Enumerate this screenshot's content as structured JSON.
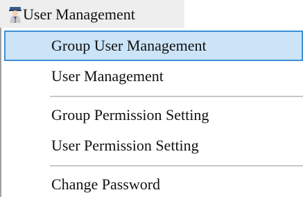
{
  "menubar": {
    "title": "User Management",
    "icon": "user-icon"
  },
  "menu": {
    "items": [
      {
        "label": "Group User Management",
        "highlighted": true
      },
      {
        "label": "User Management"
      },
      {
        "label": "Group Permission Setting"
      },
      {
        "label": "User Permission Setting"
      },
      {
        "label": "Change Password"
      }
    ]
  },
  "colors": {
    "highlight_fill": "#cce4f7",
    "highlight_border": "#3d8fd6",
    "separator": "#c8c8c8"
  }
}
